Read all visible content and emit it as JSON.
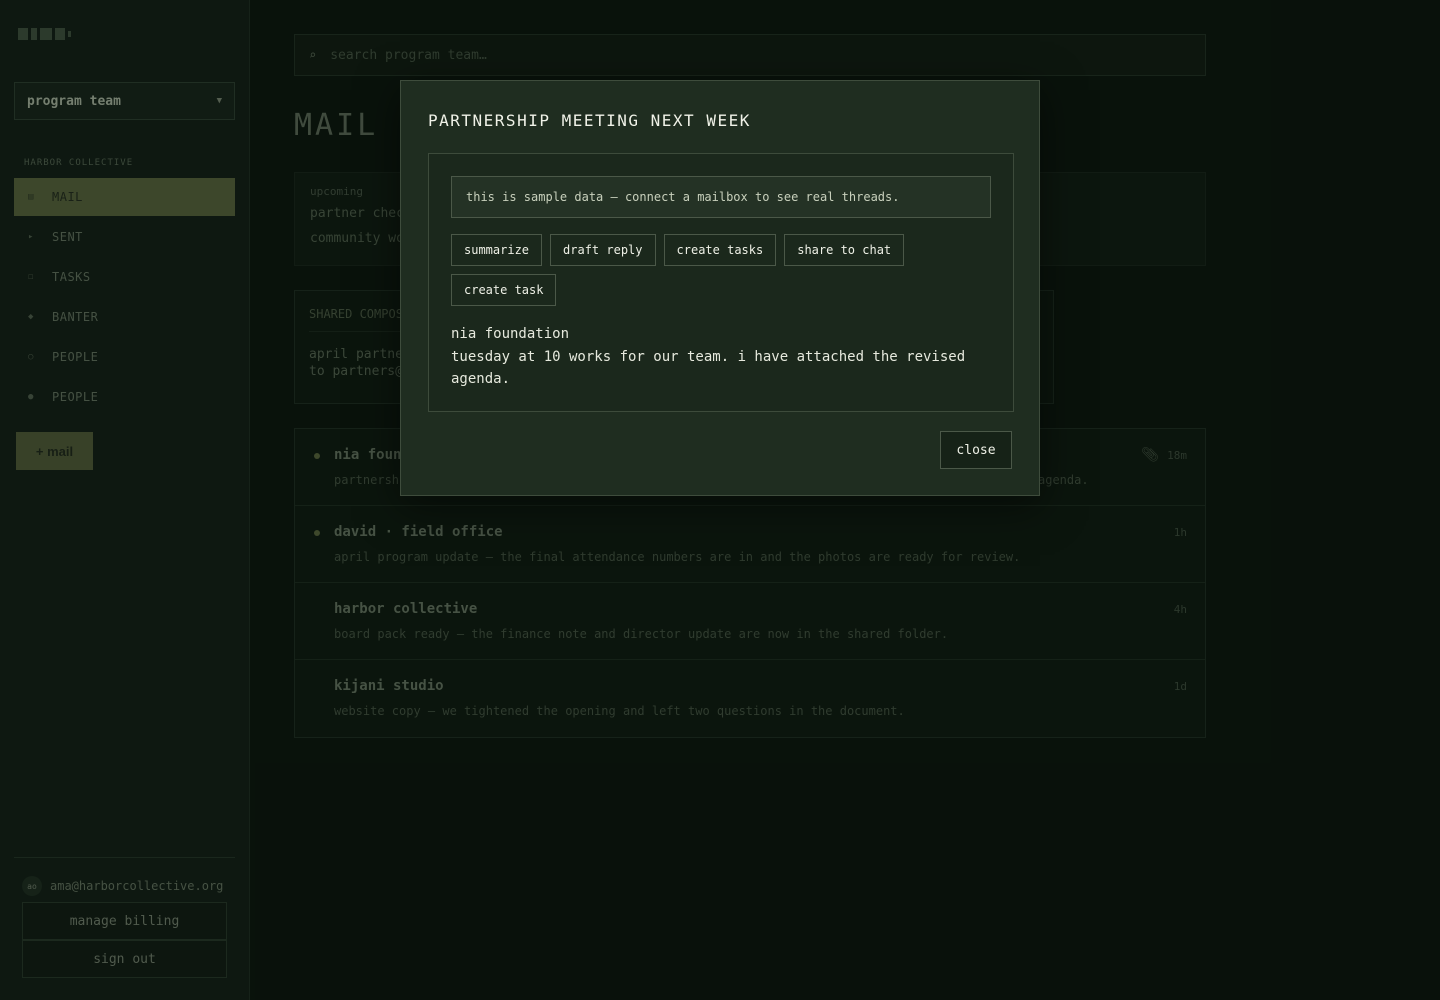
{
  "sidebar": {
    "workspace": "program team",
    "section_label": "HARBOR COLLECTIVE",
    "items": [
      {
        "label": "MAIL",
        "icon": "▤"
      },
      {
        "label": "SENT",
        "icon": "▸"
      },
      {
        "label": "TASKS",
        "icon": "☐"
      },
      {
        "label": "BANTER",
        "icon": "◆"
      },
      {
        "label": "PEOPLE",
        "icon": "○"
      },
      {
        "label": "PEOPLE",
        "icon": "●"
      }
    ],
    "new_mail_label": "+ mail",
    "account": {
      "initials": "ao",
      "email": "ama@harborcollective.org"
    },
    "manage_billing_label": "manage billing",
    "sign_out_label": "sign out"
  },
  "search": {
    "placeholder": "search program team…",
    "icon": "⌕"
  },
  "page_title": "MAIL",
  "upcoming": {
    "label": "upcoming",
    "lines": [
      "partner chec",
      "community wo"
    ]
  },
  "compose": {
    "head": "SHARED COMPOSI",
    "line1": "april partne",
    "line2": "to partners@"
  },
  "threads": [
    {
      "sender": "nia foun",
      "preview": "partnersh",
      "preview_tail": "agenda.",
      "time": "18m",
      "unread": true,
      "attachment": true
    },
    {
      "sender": "david · field office",
      "preview": "april program update — the final attendance numbers are in and the photos are ready for review.",
      "time": "1h",
      "unread": true,
      "attachment": false
    },
    {
      "sender": "harbor collective",
      "preview": "board pack ready — the finance note and director update are now in the shared folder.",
      "time": "4h",
      "unread": false,
      "attachment": false
    },
    {
      "sender": "kijani studio",
      "preview": "website copy — we tightened the opening and left two questions in the document.",
      "time": "1d",
      "unread": false,
      "attachment": false
    }
  ],
  "modal": {
    "title": "PARTNERSHIP MEETING NEXT WEEK",
    "notice": "this is sample data — connect a mailbox to see real threads.",
    "actions": [
      "summarize",
      "draft reply",
      "create tasks",
      "share to chat",
      "create task"
    ],
    "from": "nia foundation",
    "body": "tuesday at 10 works for our team. i have attached the revised agenda.",
    "close_label": "close"
  }
}
